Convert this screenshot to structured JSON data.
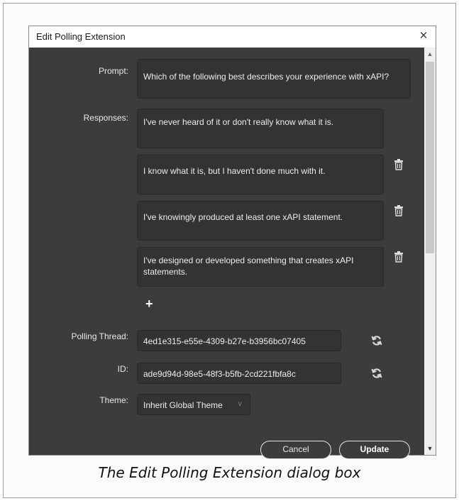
{
  "dialog": {
    "title": "Edit Polling Extension",
    "close_label": "×"
  },
  "form": {
    "prompt_label": "Prompt:",
    "prompt_value": "Which of the following best describes your experience with xAPI?",
    "responses_label": "Responses:",
    "responses": [
      "I've never heard of it or don't really know what it is.",
      "I know what it is, but I haven't done much with it.",
      "I've knowingly produced at least one xAPI statement.",
      "I've designed or developed something that creates xAPI statements."
    ],
    "add_response_label": "+",
    "polling_thread_label": "Polling Thread:",
    "polling_thread_value": "4ed1e315-e55e-4309-b27e-b3956bc07405",
    "id_label": "ID:",
    "id_value": "ade9d94d-98e5-48f3-b5fb-2cd221fbfa8c",
    "theme_label": "Theme:",
    "theme_value": "Inherit Global Theme"
  },
  "buttons": {
    "cancel": "Cancel",
    "update": "Update"
  },
  "caption": "The Edit Polling Extension dialog box",
  "colors": {
    "panel_bg": "#3c3c3c",
    "field_bg": "#333333",
    "text": "#ececec"
  },
  "icons": {
    "trash": "trash-icon",
    "refresh": "refresh-icon",
    "close": "close-icon",
    "add": "plus-icon"
  }
}
